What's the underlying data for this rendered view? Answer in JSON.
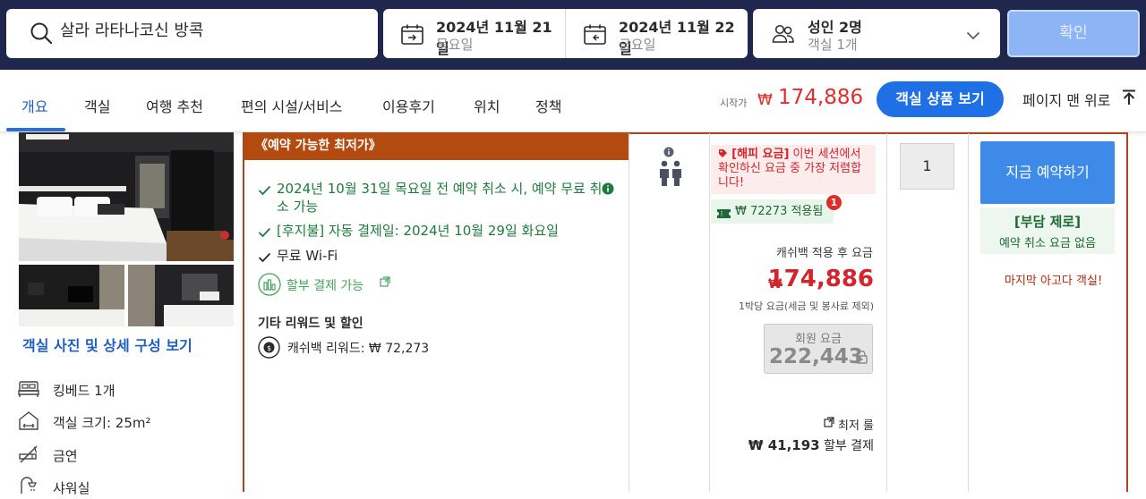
{
  "search": {
    "destination": "살라 라타나코신 방콕",
    "checkin_date": "2024년 11월 21일",
    "checkin_day": "목요일",
    "checkout_date": "2024년 11월 22일",
    "checkout_day": "금요일",
    "guests": "성인 2명",
    "rooms": "객실 1개",
    "confirm_label": "확인"
  },
  "tabs": [
    "개요",
    "객실",
    "여행 추천",
    "편의 시설/서비스",
    "이용후기",
    "위치",
    "정책"
  ],
  "header_price": {
    "label": "시작가",
    "currency": "₩",
    "amount": "174,886",
    "view_rooms_label": "객실 상품 보기",
    "to_top_label": "페이지 맨 위로"
  },
  "room": {
    "details_link": "객실 사진 및 상세 구성 보기",
    "amenities": [
      "킹베드 1개",
      "객실 크기: 25m²",
      "금연",
      "샤워실"
    ]
  },
  "offer": {
    "header": "《예약 가능한 최저가》",
    "conditions": [
      "2024년 10월 31일 목요일 전 예약 취소 시, 예약 무료 취소 가능",
      "[후지불] 자동 결제일: 2024년 10월 29일 화요일"
    ],
    "wifi": "무료 Wi-Fi",
    "installment": "할부 결제 가능",
    "extra_title": "기타 리워드 및 할인",
    "cashback_reward": "캐쉬백 리워드: ₩ 72,273"
  },
  "pricing": {
    "happy_tag": "[해피 요금]",
    "happy_text": " 이번 세션에서 확인하신 요금 중 가장 저렴합니다!",
    "coupon_text": "₩ 72273 적용됨",
    "coupon_badge": "1",
    "cashback_label": "캐쉬백 적용 후 요금",
    "currency": "₩",
    "price": "174,886",
    "per_night": "1박당 요금(세금 및 봉사료 제외)",
    "member_label": "회원 요금",
    "member_price": "222,443",
    "lowest_label": "최저 룰",
    "installment_amount": "₩ 41,193",
    "installment_suffix": " 할부 결제"
  },
  "quantity": "1",
  "booking": {
    "book_now": "지금 예약하기",
    "no_cost_title": "[부담 제로]",
    "no_cost_text": "예약 취소 요금 없음",
    "last_room": "마지막 아고다 객실!"
  },
  "colors": {
    "navy": "#20274d",
    "primary_blue": "#1f6fe5",
    "price_red": "#d4242a",
    "offer_orange": "#b34a10",
    "green": "#1e7a3c"
  }
}
